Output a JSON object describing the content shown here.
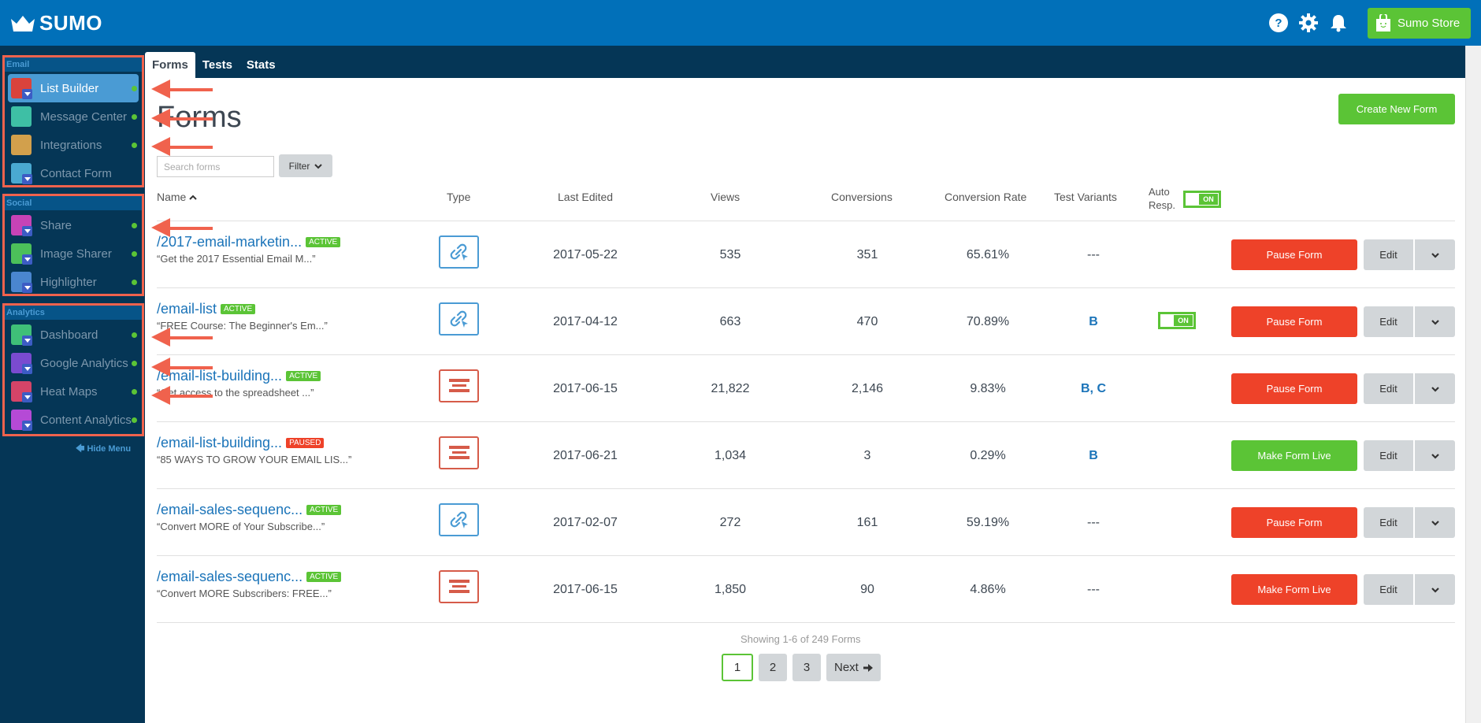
{
  "app": {
    "logo_text": "SUMO",
    "store_button": "Sumo Store",
    "brand_color": "#0170b9",
    "accent_green": "#5bc436",
    "accent_red": "#ee4229"
  },
  "tabs": [
    {
      "label": "Forms",
      "active": true
    },
    {
      "label": "Tests",
      "active": false
    },
    {
      "label": "Stats",
      "active": false
    }
  ],
  "sidebar": {
    "groups": [
      {
        "title": "Email",
        "items": [
          {
            "label": "List Builder",
            "icon": "list-builder-icon",
            "active": true,
            "status": true
          },
          {
            "label": "Message Center",
            "icon": "message-center-icon",
            "active": false,
            "status": true
          },
          {
            "label": "Integrations",
            "icon": "integrations-icon",
            "active": false,
            "status": true
          },
          {
            "label": "Contact Form",
            "icon": "contact-form-icon",
            "active": false,
            "status": false
          }
        ]
      },
      {
        "title": "Social",
        "items": [
          {
            "label": "Share",
            "icon": "share-icon",
            "active": false,
            "status": true
          },
          {
            "label": "Image Sharer",
            "icon": "image-sharer-icon",
            "active": false,
            "status": true
          },
          {
            "label": "Highlighter",
            "icon": "highlighter-icon",
            "active": false,
            "status": true
          }
        ]
      },
      {
        "title": "Analytics",
        "items": [
          {
            "label": "Dashboard",
            "icon": "dashboard-icon",
            "active": false,
            "status": true
          },
          {
            "label": "Google Analytics",
            "icon": "google-analytics-icon",
            "active": false,
            "status": true
          },
          {
            "label": "Heat Maps",
            "icon": "heat-maps-icon",
            "active": false,
            "status": true
          },
          {
            "label": "Content Analytics",
            "icon": "content-analytics-icon",
            "active": false,
            "status": true
          }
        ]
      }
    ],
    "hide_menu": "Hide Menu"
  },
  "page": {
    "title": "Forms",
    "create_button": "Create New Form",
    "search_placeholder": "Search forms",
    "filter_label": "Filter"
  },
  "table": {
    "headers": {
      "name": "Name",
      "type": "Type",
      "last_edited": "Last Edited",
      "views": "Views",
      "conversions": "Conversions",
      "conversion_rate": "Conversion Rate",
      "test_variants": "Test Variants",
      "auto_resp_1": "Auto",
      "auto_resp_2": "Resp.",
      "auto_resp_toggle": "ON"
    },
    "rows": [
      {
        "name": "/2017-email-marketin...",
        "status": "ACTIVE",
        "subtitle": "“Get the 2017 Essential Email M...”",
        "type": "link",
        "last_edited": "2017-05-22",
        "views": "535",
        "conversions": "351",
        "rate": "65.61%",
        "variants": "---",
        "auto_resp": "",
        "action": "Pause Form",
        "edit": "Edit"
      },
      {
        "name": "/email-list",
        "status": "ACTIVE",
        "subtitle": "“FREE Course: The Beginner's Em...”",
        "type": "link",
        "last_edited": "2017-04-12",
        "views": "663",
        "conversions": "470",
        "rate": "70.89%",
        "variants": "B",
        "auto_resp": "ON",
        "action": "Pause Form",
        "edit": "Edit"
      },
      {
        "name": "/email-list-building...",
        "status": "ACTIVE",
        "subtitle": "“Get access to the spreadsheet ...”",
        "type": "bar",
        "last_edited": "2017-06-15",
        "views": "21,822",
        "conversions": "2,146",
        "rate": "9.83%",
        "variants": "B, C",
        "auto_resp": "",
        "action": "Pause Form",
        "edit": "Edit"
      },
      {
        "name": "/email-list-building...",
        "status": "PAUSED",
        "subtitle": "“85 WAYS TO GROW YOUR EMAIL LIS...”",
        "type": "bar",
        "last_edited": "2017-06-21",
        "views": "1,034",
        "conversions": "3",
        "rate": "0.29%",
        "variants": "B",
        "auto_resp": "",
        "action": "Make Form Live",
        "edit": "Edit"
      },
      {
        "name": "/email-sales-sequenc...",
        "status": "ACTIVE",
        "subtitle": "“Convert MORE of Your Subscribe...”",
        "type": "link",
        "last_edited": "2017-02-07",
        "views": "272",
        "conversions": "161",
        "rate": "59.19%",
        "variants": "---",
        "auto_resp": "",
        "action": "Pause Form",
        "edit": "Edit"
      },
      {
        "name": "/email-sales-sequenc...",
        "status": "ACTIVE",
        "subtitle": "“Convert MORE Subscribers: FREE...”",
        "type": "bar",
        "last_edited": "2017-06-15",
        "views": "1,850",
        "conversions": "90",
        "rate": "4.86%",
        "variants": "---",
        "auto_resp": "",
        "action": "Make Form Live",
        "edit": "Edit"
      }
    ]
  },
  "pagination": {
    "summary": "Showing 1-6 of 249 Forms",
    "pages": [
      "1",
      "2",
      "3"
    ],
    "current": "1",
    "next": "Next"
  }
}
